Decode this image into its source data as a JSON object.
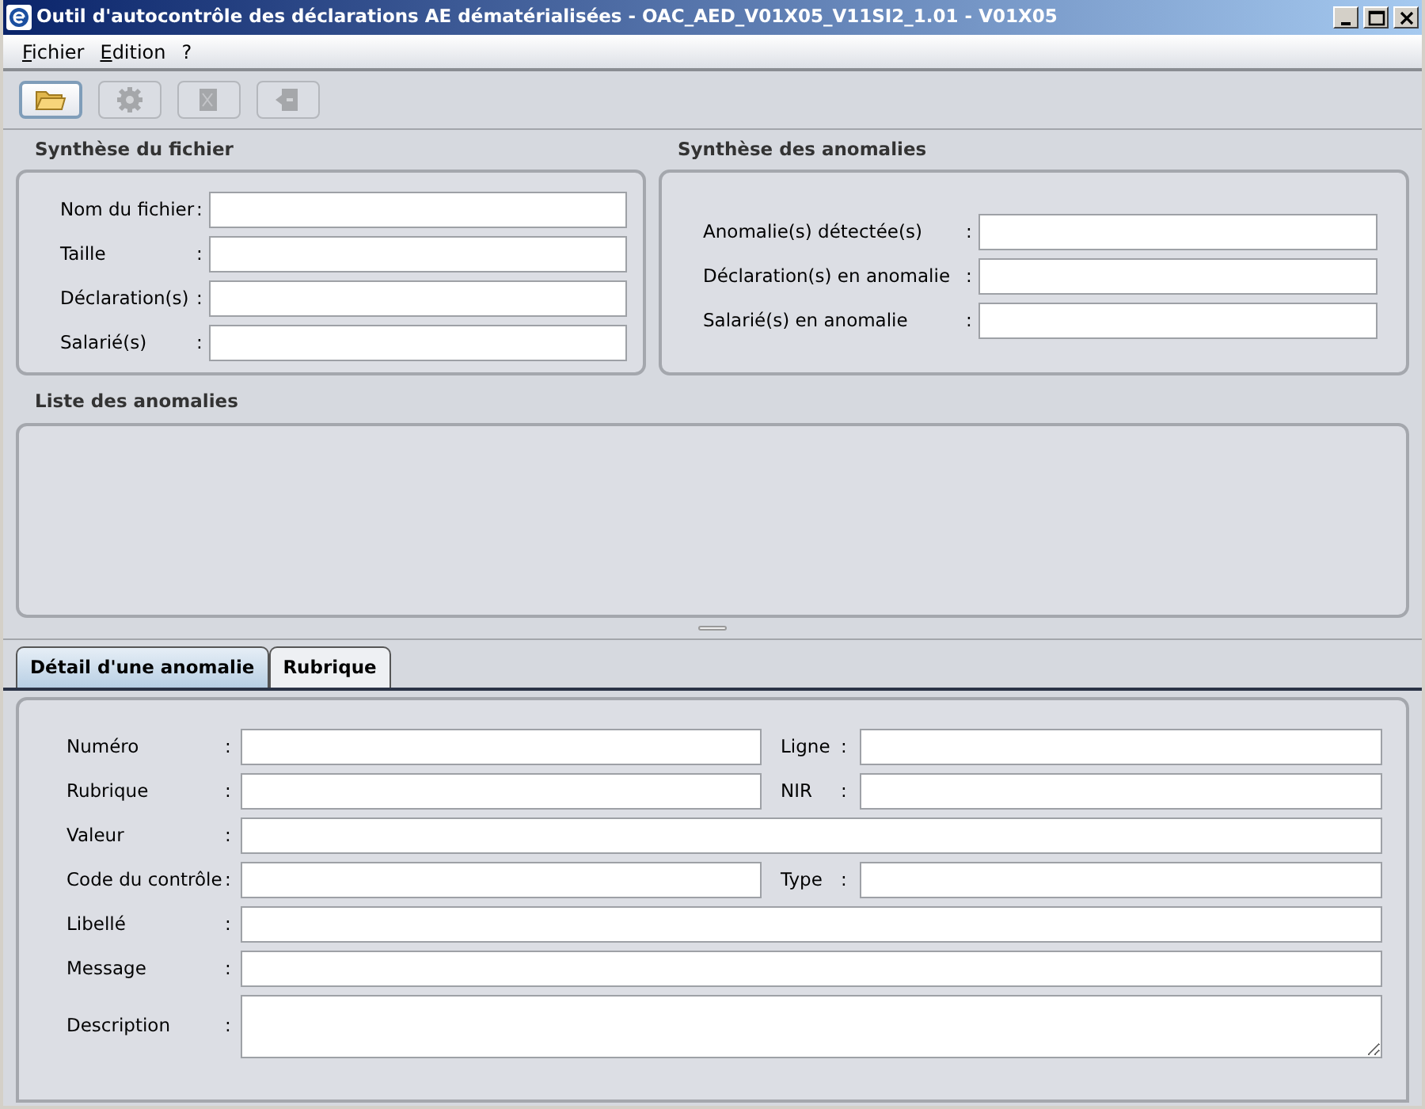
{
  "window": {
    "title": "Outil d'autocontrôle des déclarations AE dématérialisées - OAC_AED_V01X05_V11SI2_1.01 - V01X05"
  },
  "menu": [
    {
      "label": "Fichier",
      "mnemonic": true
    },
    {
      "label": "Edition",
      "mnemonic": true
    },
    {
      "label": "?"
    }
  ],
  "toolbar": [
    {
      "kind": "folder",
      "disabled": false
    },
    {
      "kind": "gear",
      "disabled": true
    },
    {
      "kind": "document",
      "disabled": true
    },
    {
      "kind": "export",
      "disabled": true
    }
  ],
  "file_summary": {
    "title": "Synthèse du fichier",
    "fields": [
      {
        "label": "Nom du fichier",
        "colon": ":"
      },
      {
        "label": "Taille",
        "colon": ":"
      },
      {
        "label": "Déclaration(s)",
        "colon": ":"
      },
      {
        "label": "Salarié(s)",
        "colon": ":"
      }
    ]
  },
  "anomaly_summary": {
    "title": "Synthèse des anomalies",
    "fields": [
      {
        "label": "Anomalie(s) détectée(s)",
        "colon": ":"
      },
      {
        "label": "Déclaration(s) en anomalie",
        "colon": ":"
      },
      {
        "label": "Salarié(s) en anomalie",
        "colon": ":"
      }
    ]
  },
  "anomaly_list": {
    "title": "Liste des anomalies"
  },
  "tabs": [
    {
      "label": "Détail d'une anomalie",
      "selected": true
    },
    {
      "label": "Rubrique",
      "selected": false
    }
  ],
  "detail_rows": [
    [
      {
        "label": "Numéro",
        "colon": ":"
      },
      {
        "label": "Ligne",
        "colon": ":"
      }
    ],
    [
      {
        "label": "Rubrique",
        "colon": ":"
      },
      {
        "label": "NIR",
        "colon": ":"
      }
    ],
    [
      {
        "label": "Valeur",
        "colon": ":"
      }
    ],
    [
      {
        "label": "Code du contrôle",
        "colon": ":"
      },
      {
        "label": "Type",
        "colon": ":"
      }
    ],
    [
      {
        "label": "Libellé",
        "colon": ":"
      }
    ],
    [
      {
        "label": "Message",
        "colon": ":"
      }
    ],
    [
      {
        "label": "Description",
        "colon": ":",
        "kind": "tall"
      }
    ]
  ]
}
